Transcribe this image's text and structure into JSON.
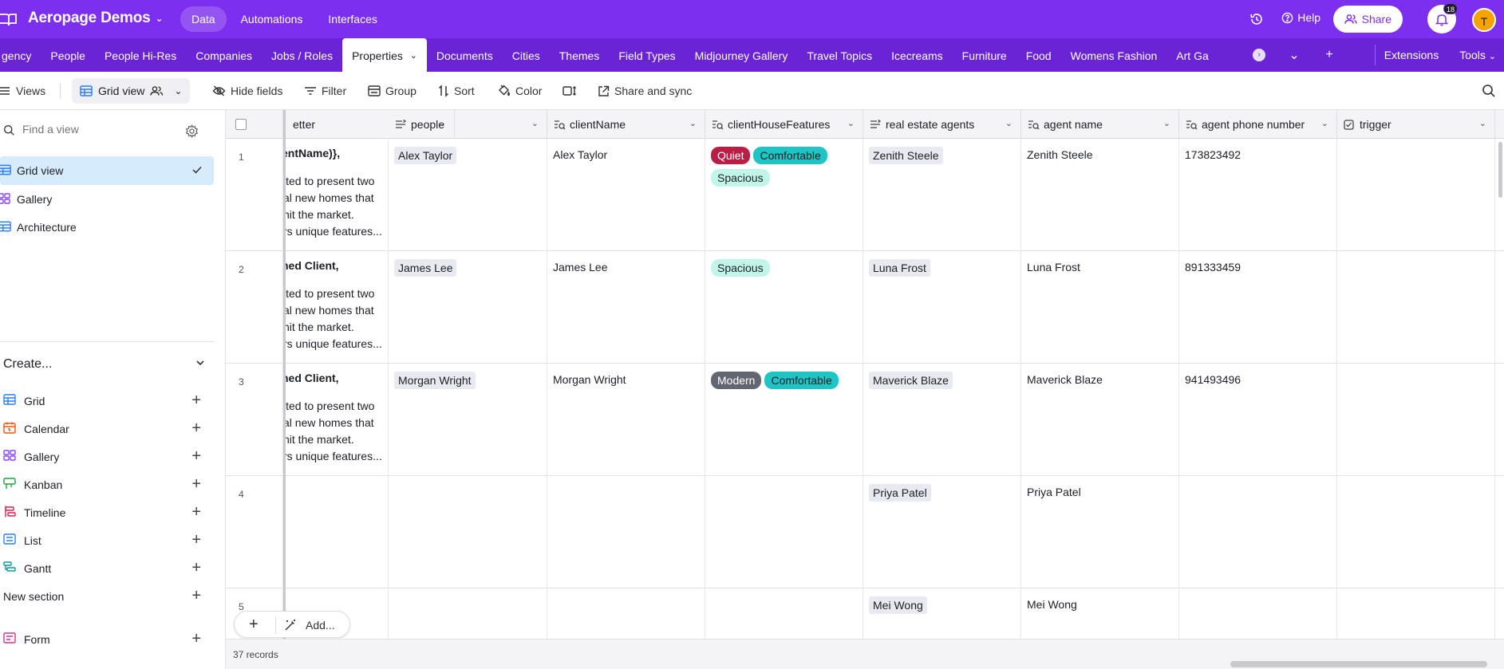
{
  "app": {
    "base_name": "Aeropage Demos",
    "nav": [
      "Data",
      "Automations",
      "Interfaces"
    ],
    "help_label": "Help",
    "share_label": "Share",
    "notifications_count": "18",
    "avatar_initial": "T"
  },
  "tables": {
    "items": [
      "gency",
      "People",
      "People Hi-Res",
      "Companies",
      "Jobs / Roles",
      "Properties",
      "Documents",
      "Cities",
      "Themes",
      "Field Types",
      "Midjourney Gallery",
      "Travel Topics",
      "Icecreams",
      "Furniture",
      "Food",
      "Womens Fashion",
      "Art Ga"
    ],
    "active": "Properties",
    "extensions_label": "Extensions",
    "tools_label": "Tools"
  },
  "toolbar": {
    "views_label": "Views",
    "grid_view_label": "Grid view",
    "hide_fields": "Hide fields",
    "filter": "Filter",
    "group": "Group",
    "sort": "Sort",
    "color": "Color",
    "share_sync": "Share and sync"
  },
  "sidebar": {
    "find_placeholder": "Find a view",
    "views": [
      "Grid view",
      "Gallery",
      "Architecture"
    ],
    "create_label": "Create...",
    "create_items": [
      "Grid",
      "Calendar",
      "Gallery",
      "Kanban",
      "Timeline",
      "List",
      "Gantt",
      "New section",
      "Form"
    ]
  },
  "grid": {
    "columns": [
      "etter",
      "people",
      "clientName",
      "clientHouseFeatures",
      "real estate agents",
      "agent name",
      "agent phone number",
      "trigger"
    ],
    "rows": [
      {
        "num": "1",
        "letter_first": "entName)},",
        "letter_lines": [
          "ited to present two",
          "al new homes that",
          "hit the market.",
          "rs unique features..."
        ],
        "people": "Alex Taylor",
        "clientName": "Alex Taylor",
        "features": [
          "Quiet",
          "Comfortable",
          "Spacious"
        ],
        "agent": "Zenith Steele",
        "agent_name": "Zenith Steele",
        "phone": "173823492"
      },
      {
        "num": "2",
        "letter_first": "ned Client,",
        "letter_lines": [
          "ited to present two",
          "al new homes that",
          "hit the market.",
          "rs unique features..."
        ],
        "people": "James Lee",
        "clientName": "James Lee",
        "features": [
          "Spacious"
        ],
        "agent": "Luna Frost",
        "agent_name": "Luna Frost",
        "phone": "891333459"
      },
      {
        "num": "3",
        "letter_first": "ned Client,",
        "letter_lines": [
          "ited to present two",
          "al new homes that",
          "hit the market.",
          "rs unique features..."
        ],
        "people": "Morgan Wright",
        "clientName": "Morgan Wright",
        "features": [
          "Modern",
          "Comfortable"
        ],
        "agent": "Maverick Blaze",
        "agent_name": "Maverick Blaze",
        "phone": "941493496"
      },
      {
        "num": "4",
        "letter_first": "",
        "letter_lines": [],
        "people": "",
        "clientName": "",
        "features": [],
        "agent": "Priya Patel",
        "agent_name": "Priya Patel",
        "phone": ""
      },
      {
        "num": "5",
        "letter_first": "",
        "letter_lines": [],
        "people": "",
        "clientName": "",
        "features": [],
        "agent": "Mei Wong",
        "agent_name": "Mei Wong",
        "phone": ""
      }
    ],
    "tag_colors": {
      "Quiet": {
        "bg": "#ba1e45",
        "fg": "#ffffff"
      },
      "Comfortable": {
        "bg": "#20c4c4",
        "fg": "#1d1f25"
      },
      "Spacious": {
        "bg": "#c2f5e9",
        "fg": "#1d1f25"
      },
      "Modern": {
        "bg": "#616670",
        "fg": "#ffffff"
      }
    },
    "records_label": "37 records",
    "add_label": "Add..."
  }
}
